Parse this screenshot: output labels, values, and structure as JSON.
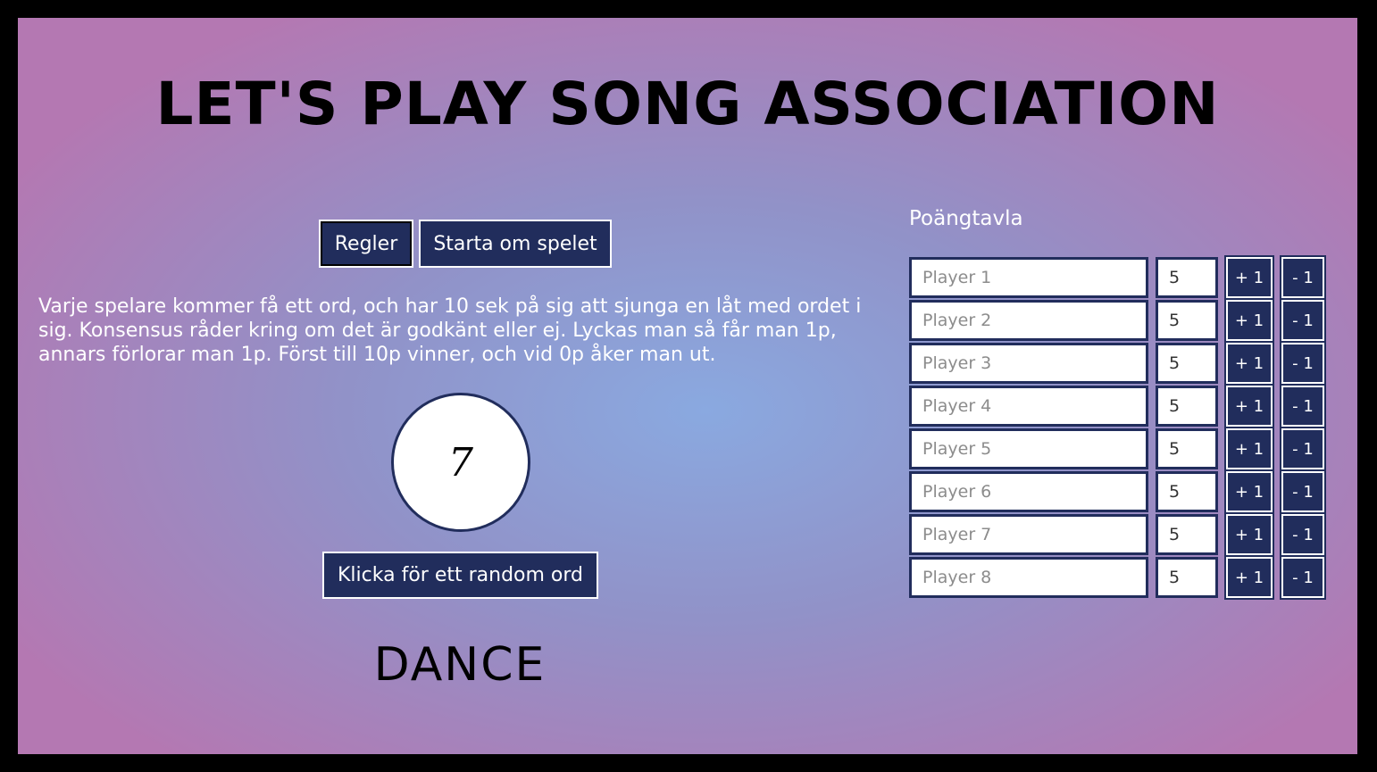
{
  "header": {
    "title": "LET'S PLAY SONG ASSOCIATION"
  },
  "controls": {
    "rules_label": "Regler",
    "restart_label": "Starta om spelet"
  },
  "rules_text": "Varje spelare kommer få ett ord, och har 10 sek på sig att sjunga en låt med ordet i sig.  Konsensus råder kring om det är godkänt eller ej.  Lyckas man så får man 1p, annars förlorar man 1p.  Först till 10p vinner, och vid 0p åker man ut.",
  "timer": {
    "value": "7"
  },
  "random": {
    "label": "Klicka för ett random ord"
  },
  "word": {
    "current": "DANCE"
  },
  "scoreboard": {
    "title": "Poängtavla",
    "plus_label": "+ 1",
    "minus_label": "- 1",
    "players": [
      {
        "name": "Player 1",
        "score": "5"
      },
      {
        "name": "Player 2",
        "score": "5"
      },
      {
        "name": "Player 3",
        "score": "5"
      },
      {
        "name": "Player 4",
        "score": "5"
      },
      {
        "name": "Player 5",
        "score": "5"
      },
      {
        "name": "Player 6",
        "score": "5"
      },
      {
        "name": "Player 7",
        "score": "5"
      },
      {
        "name": "Player 8",
        "score": "5"
      }
    ]
  },
  "colors": {
    "accent": "#212d5c",
    "background_center": "#8aa9e0",
    "background_edge": "#b478b2"
  }
}
